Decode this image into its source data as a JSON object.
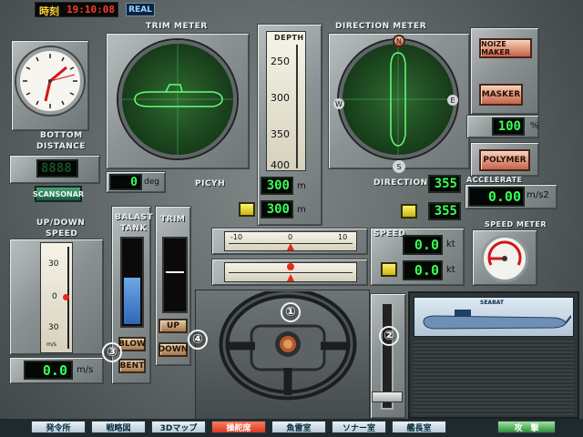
{
  "header": {
    "time_label": "時刻",
    "time": "19:10:08",
    "real": "REAL"
  },
  "trim_meter": {
    "title": "TRIM METER",
    "pitch_label": "PICYH",
    "pitch_value": "0",
    "pitch_unit": "deg"
  },
  "depth": {
    "title": "DEPTH",
    "ticks": [
      "250",
      "300",
      "350",
      "400"
    ],
    "current": "300",
    "target": "300",
    "unit": "m"
  },
  "direction_meter": {
    "title": "DIRECTION METER",
    "n": "N",
    "e": "E",
    "s": "S",
    "w": "W",
    "label": "DIRECTION",
    "current": "355",
    "target": "355"
  },
  "buttons": {
    "noize_maker": "NOIZE MAKER",
    "masker": "MASKER",
    "polymer": "POLYMER",
    "scansonar": "SCANSONAR",
    "blow": "BLOW",
    "bent": "BENT",
    "up": "UP",
    "down": "DOWN"
  },
  "masker_level": {
    "value": "100",
    "unit": "%"
  },
  "accelerate": {
    "label": "ACCELERATE",
    "value": "0.00",
    "unit": "m/s2"
  },
  "bottom_distance": {
    "label1": "BOTTOM",
    "label2": "DISTANCE",
    "value": "8888"
  },
  "updown": {
    "label1": "UP/DOWN",
    "label2": "SPEED",
    "ticks": [
      "30",
      "0",
      "30"
    ],
    "unit_small": "m/s",
    "value": "0.0",
    "unit": "m/s"
  },
  "ballast": {
    "title1": "BALAST",
    "title2": "TANK",
    "level": 0.55
  },
  "trim": {
    "title": "TRIM"
  },
  "rudder_scale": {
    "left": "-10",
    "center": "0",
    "right": "10",
    "marker": 0
  },
  "speed": {
    "label": "SPEED",
    "value1": "0.0",
    "value2": "0.0",
    "unit": "kt"
  },
  "speed_meter": {
    "label": "SPEED METER"
  },
  "sub_panel": {
    "name": "SEABAT"
  },
  "markers": [
    "①",
    "②",
    "③",
    "④"
  ],
  "tabs": [
    "発令所",
    "戦略図",
    "3Dマップ",
    "操舵席",
    "魚雷室",
    "ソナー室",
    "艦長室",
    "攻　撃"
  ],
  "colors": {
    "lcd_green": "#39ff57",
    "radar_green": "#1f5c22",
    "active_tab": "#d83a22"
  }
}
